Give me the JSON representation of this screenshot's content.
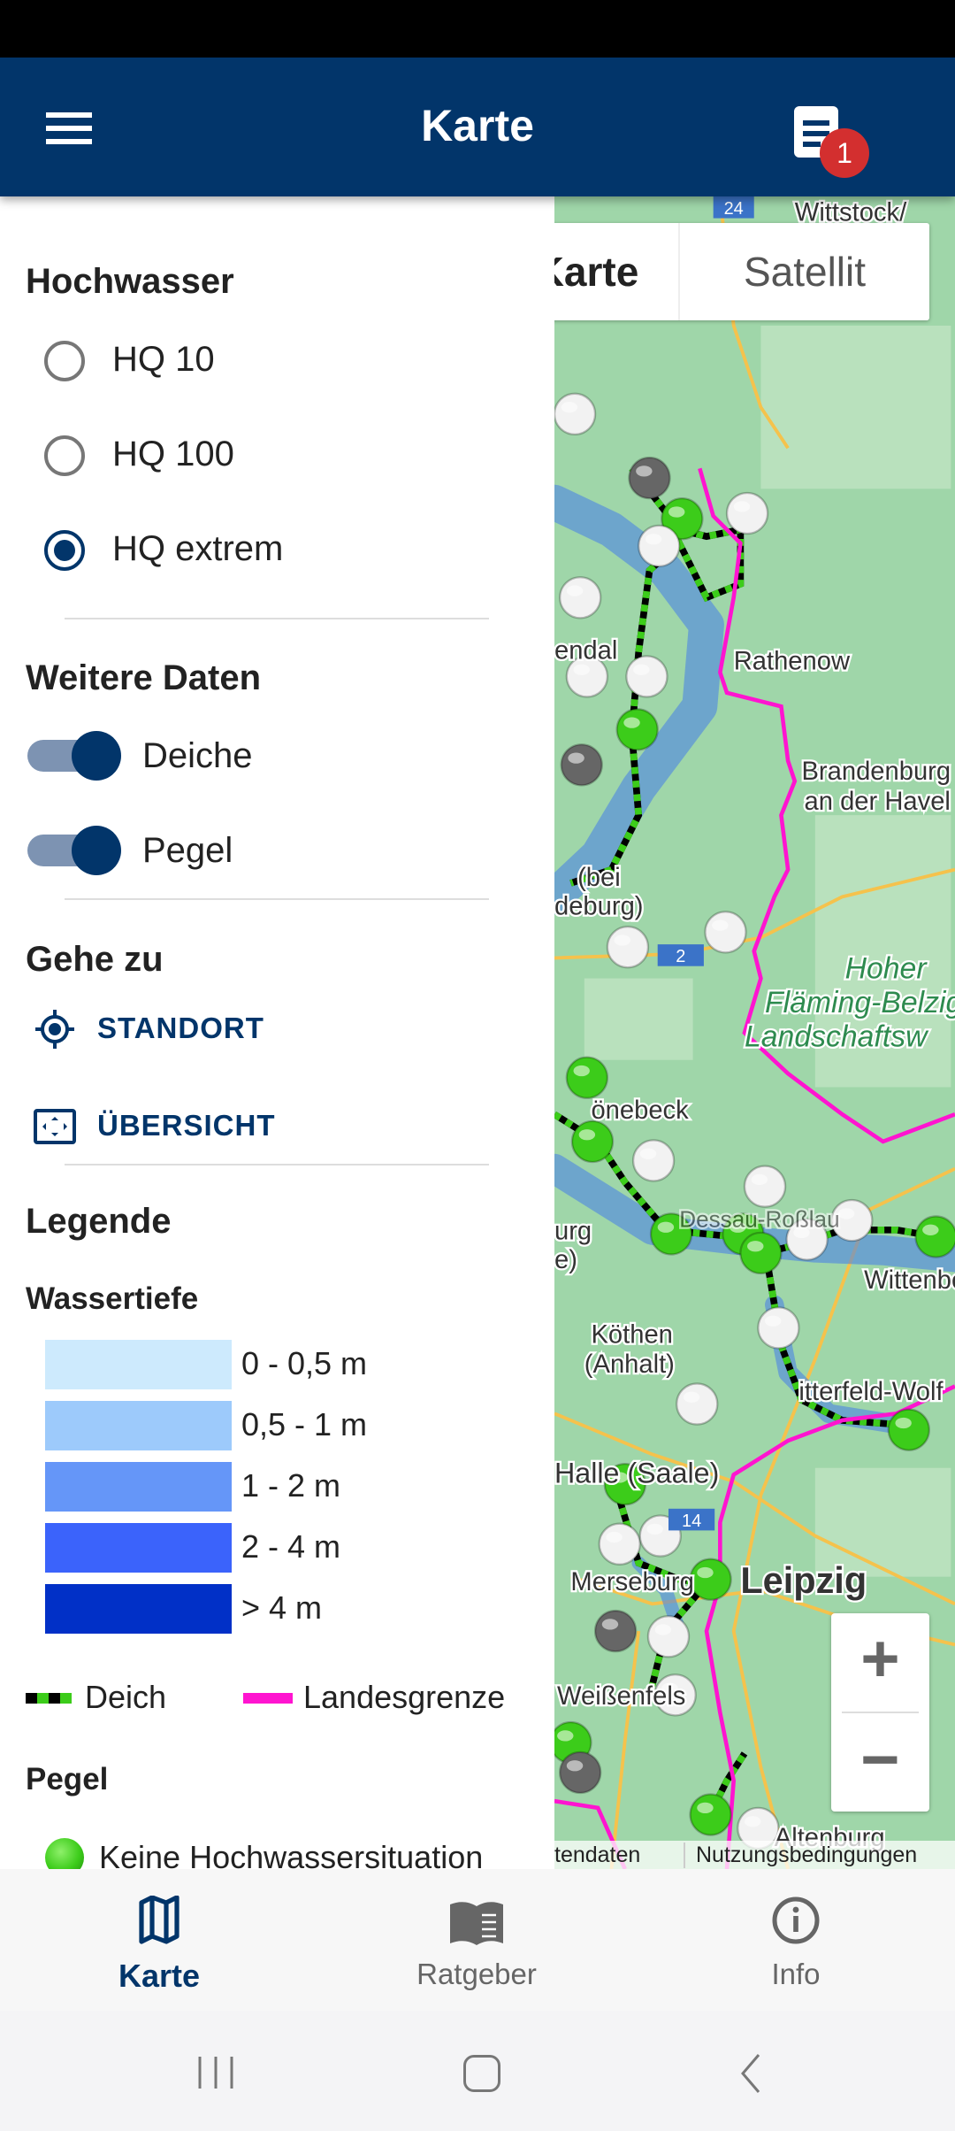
{
  "header": {
    "title": "Karte",
    "notification_count": "1"
  },
  "drawer": {
    "flood_title": "Hochwasser",
    "flood_options": [
      {
        "label": "HQ 10",
        "selected": false
      },
      {
        "label": "HQ 100",
        "selected": false
      },
      {
        "label": "HQ extrem",
        "selected": true
      }
    ],
    "more_title": "Weitere Daten",
    "toggles": [
      {
        "label": "Deiche",
        "on": true
      },
      {
        "label": "Pegel",
        "on": true
      }
    ],
    "goto_title": "Gehe zu",
    "goto": [
      {
        "label": "STANDORT",
        "icon": "gps-fixed-icon"
      },
      {
        "label": "ÜBERSICHT",
        "icon": "fullscreen-frame-icon"
      }
    ],
    "legend_title": "Legende",
    "depth_title": "Wassertiefe",
    "depths": [
      {
        "label": "0 - 0,5 m",
        "color": "#cdeafd"
      },
      {
        "label": "0,5 - 1 m",
        "color": "#9dcafb"
      },
      {
        "label": "1 - 2 m",
        "color": "#6596f8"
      },
      {
        "label": "2 - 4 m",
        "color": "#3b63fb"
      },
      {
        "label": "> 4 m",
        "color": "#0130c7"
      }
    ],
    "dike_label": "Deich",
    "border_label": "Landesgrenze",
    "gauge_title": "Pegel",
    "gauge_items": [
      {
        "label": "Keine Hochwassersituation",
        "color": "#3ccc1a"
      }
    ]
  },
  "map": {
    "type_options": [
      "Karte",
      "Satellit"
    ],
    "labels": [
      "Wittstock/",
      "Rathenow",
      "Brandenburg",
      "an der Havel",
      "Hoher",
      "Fläming-Belzig",
      "Landschaftsw",
      "önebeck",
      "Köthen",
      "(Anhalt)",
      "Halle (Saale)",
      "Leipzig",
      "Merseburg",
      "Weißenfels",
      "Altenburg",
      "Wittenberg",
      "itterfeld-Wolf",
      "endal",
      "(bei",
      "deburg)",
      "urg",
      "e)",
      "Dessau-Roßlau",
      "24",
      "2",
      "14"
    ],
    "zoom_in": "+",
    "zoom_out": "−",
    "attribution": [
      "tendaten",
      "Nutzungsbedingungen"
    ],
    "colors": {
      "border": "#ff14d0",
      "dike": "#3ccc1a",
      "gauge_normal": "#3ccc1a",
      "gauge_none": "#f2f2f2",
      "gauge_inactive": "#666666"
    }
  },
  "bottom_nav": [
    {
      "label": "Karte",
      "active": true
    },
    {
      "label": "Ratgeber",
      "active": false
    },
    {
      "label": "Info",
      "active": false
    }
  ]
}
